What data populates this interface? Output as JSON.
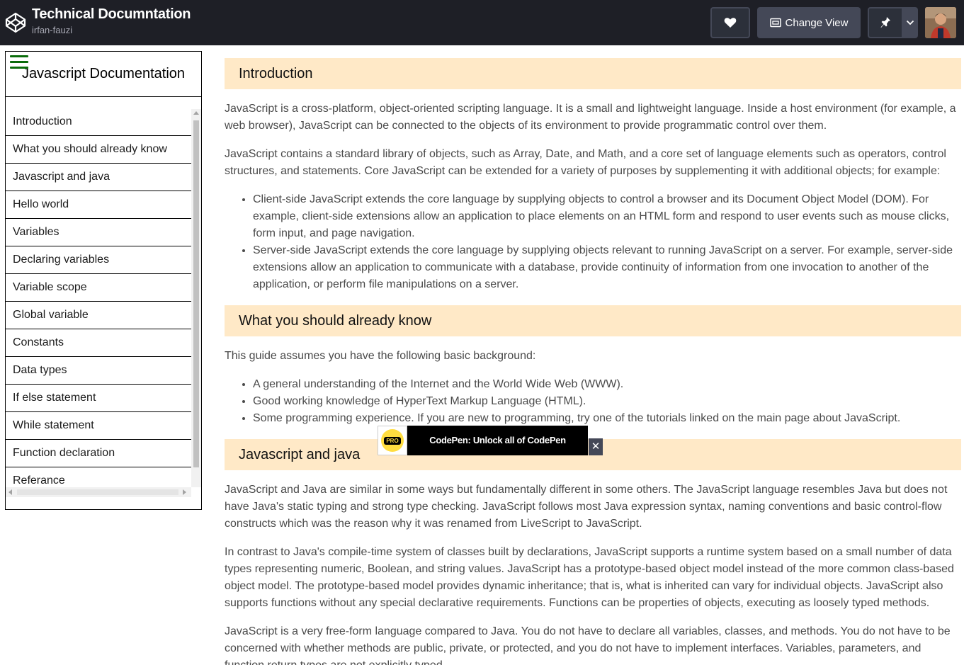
{
  "header": {
    "title": "Technical Documntation",
    "user": "irfan-fauzi",
    "change_view_label": "Change View",
    "logo_icon": "codepen-logo-icon",
    "heart_icon": "heart-icon",
    "pin_icon": "pin-icon",
    "caret_icon": "chevron-down-icon"
  },
  "sidebar": {
    "title": "Javascript Documentation",
    "menu_icon": "hamburger-icon",
    "items": [
      {
        "label": "Introduction"
      },
      {
        "label": "What you should already know"
      },
      {
        "label": "Javascript and java"
      },
      {
        "label": "Hello world"
      },
      {
        "label": "Variables"
      },
      {
        "label": "Declaring variables"
      },
      {
        "label": "Variable scope"
      },
      {
        "label": "Global variable"
      },
      {
        "label": "Constants"
      },
      {
        "label": "Data types"
      },
      {
        "label": "If else statement"
      },
      {
        "label": "While statement"
      },
      {
        "label": "Function declaration"
      },
      {
        "label": "Referance"
      }
    ]
  },
  "main": {
    "sections": [
      {
        "heading": "Introduction",
        "p1": "JavaScript is a cross-platform, object-oriented scripting language. It is a small and lightweight language. Inside a host environment (for example, a web browser), JavaScript can be connected to the objects of its environment to provide programmatic control over them.",
        "p2": "JavaScript contains a standard library of objects, such as Array, Date, and Math, and a core set of language elements such as operators, control structures, and statements. Core JavaScript can be extended for a variety of purposes by supplementing it with additional objects; for example:",
        "list": [
          "Client-side JavaScript extends the core language by supplying objects to control a browser and its Document Object Model (DOM). For example, client-side extensions allow an application to place elements on an HTML form and respond to user events such as mouse clicks, form input, and page navigation.",
          "Server-side JavaScript extends the core language by supplying objects relevant to running JavaScript on a server. For example, server-side extensions allow an application to communicate with a database, provide continuity of information from one invocation to another of the application, or perform file manipulations on a server."
        ]
      },
      {
        "heading": "What you should already know",
        "p1": "This guide assumes you have the following basic background:",
        "list": [
          "A general understanding of the Internet and the World Wide Web (WWW).",
          "Good working knowledge of HyperText Markup Language (HTML).",
          "Some programming experience. If you are new to programming, try one of the tutorials linked on the main page about JavaScript."
        ]
      },
      {
        "heading": "Javascript and java",
        "p1": "JavaScript and Java are similar in some ways but fundamentally different in some others. The JavaScript language resembles Java but does not have Java's static typing and strong type checking. JavaScript follows most Java expression syntax, naming conventions and basic control-flow constructs which was the reason why it was renamed from LiveScript to JavaScript.",
        "p2": "In contrast to Java's compile-time system of classes built by declarations, JavaScript supports a runtime system based on a small number of data types representing numeric, Boolean, and string values. JavaScript has a prototype-based object model instead of the more common class-based object model. The prototype-based model provides dynamic inheritance; that is, what is inherited can vary for individual objects. JavaScript also supports functions without any special declarative requirements. Functions can be properties of objects, executing as loosely typed methods.",
        "p3": "JavaScript is a very free-form language compared to Java. You do not have to declare all variables, classes, and methods. You do not have to be concerned with whether methods are public, private, or protected, and you do not have to implement interfaces. Variables, parameters, and function return types are not explicitly typed."
      }
    ]
  },
  "toast": {
    "badge": "PRO",
    "message": "CodePen: Unlock all of CodePen",
    "close": "✕"
  },
  "colors": {
    "header_bg": "#1e1f26",
    "section_heading_bg": "#ffe9c7",
    "hamburger": "#0a6b0a"
  }
}
